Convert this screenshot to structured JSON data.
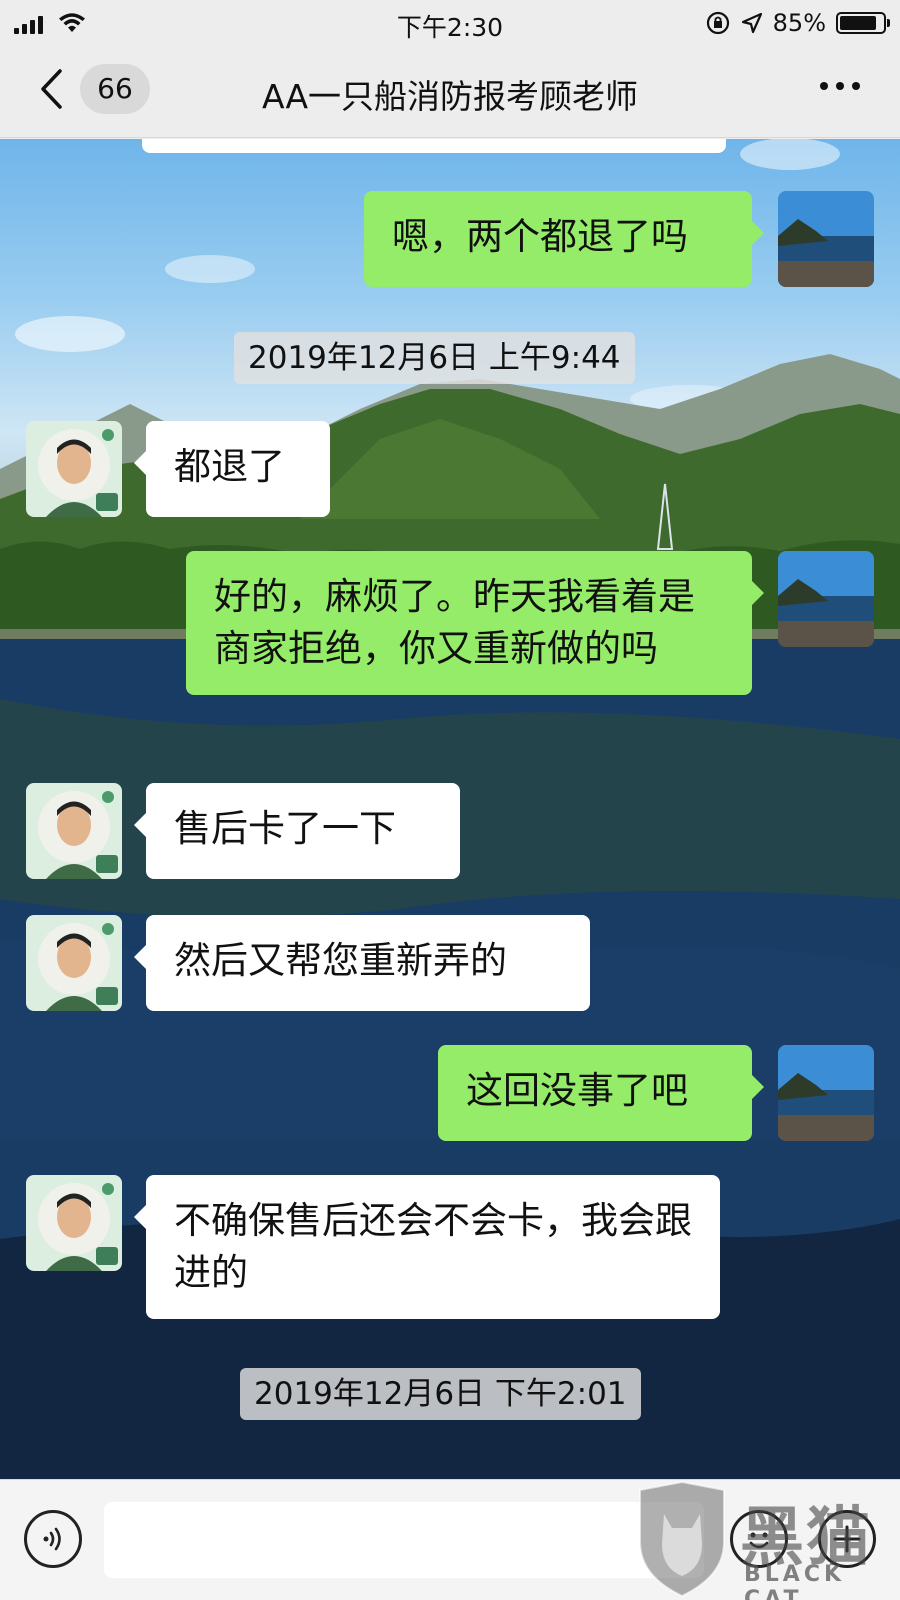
{
  "status_bar": {
    "time": "下午2:30",
    "battery": "85%",
    "battery_level": 0.85
  },
  "nav": {
    "unread_count": "66",
    "title": "AA一只船消防报考顾老师"
  },
  "messages": [
    {
      "side": "out",
      "text": "嗯，两个都退了吗"
    },
    {
      "type": "timestamp",
      "text": "2019年12月6日 上午9:44"
    },
    {
      "side": "in",
      "text": "都退了"
    },
    {
      "side": "out",
      "text": "好的，麻烦了。昨天我看着是商家拒绝，你又重新做的吗"
    },
    {
      "side": "in",
      "text": "售后卡了一下"
    },
    {
      "side": "in",
      "text": "然后又帮您重新弄的"
    },
    {
      "side": "out",
      "text": "这回没事了吧"
    },
    {
      "side": "in",
      "text": "不确保售后还会不会卡，我会跟进的"
    },
    {
      "type": "timestamp",
      "text": "2019年12月6日 下午2:01"
    }
  ],
  "input": {
    "placeholder": ""
  },
  "watermark": {
    "name": "黑猫",
    "brand": "BLACK CAT"
  },
  "colors": {
    "outgoing_bubble": "#95ec69",
    "incoming_bubble": "#ffffff",
    "bar_background": "#ededed"
  }
}
